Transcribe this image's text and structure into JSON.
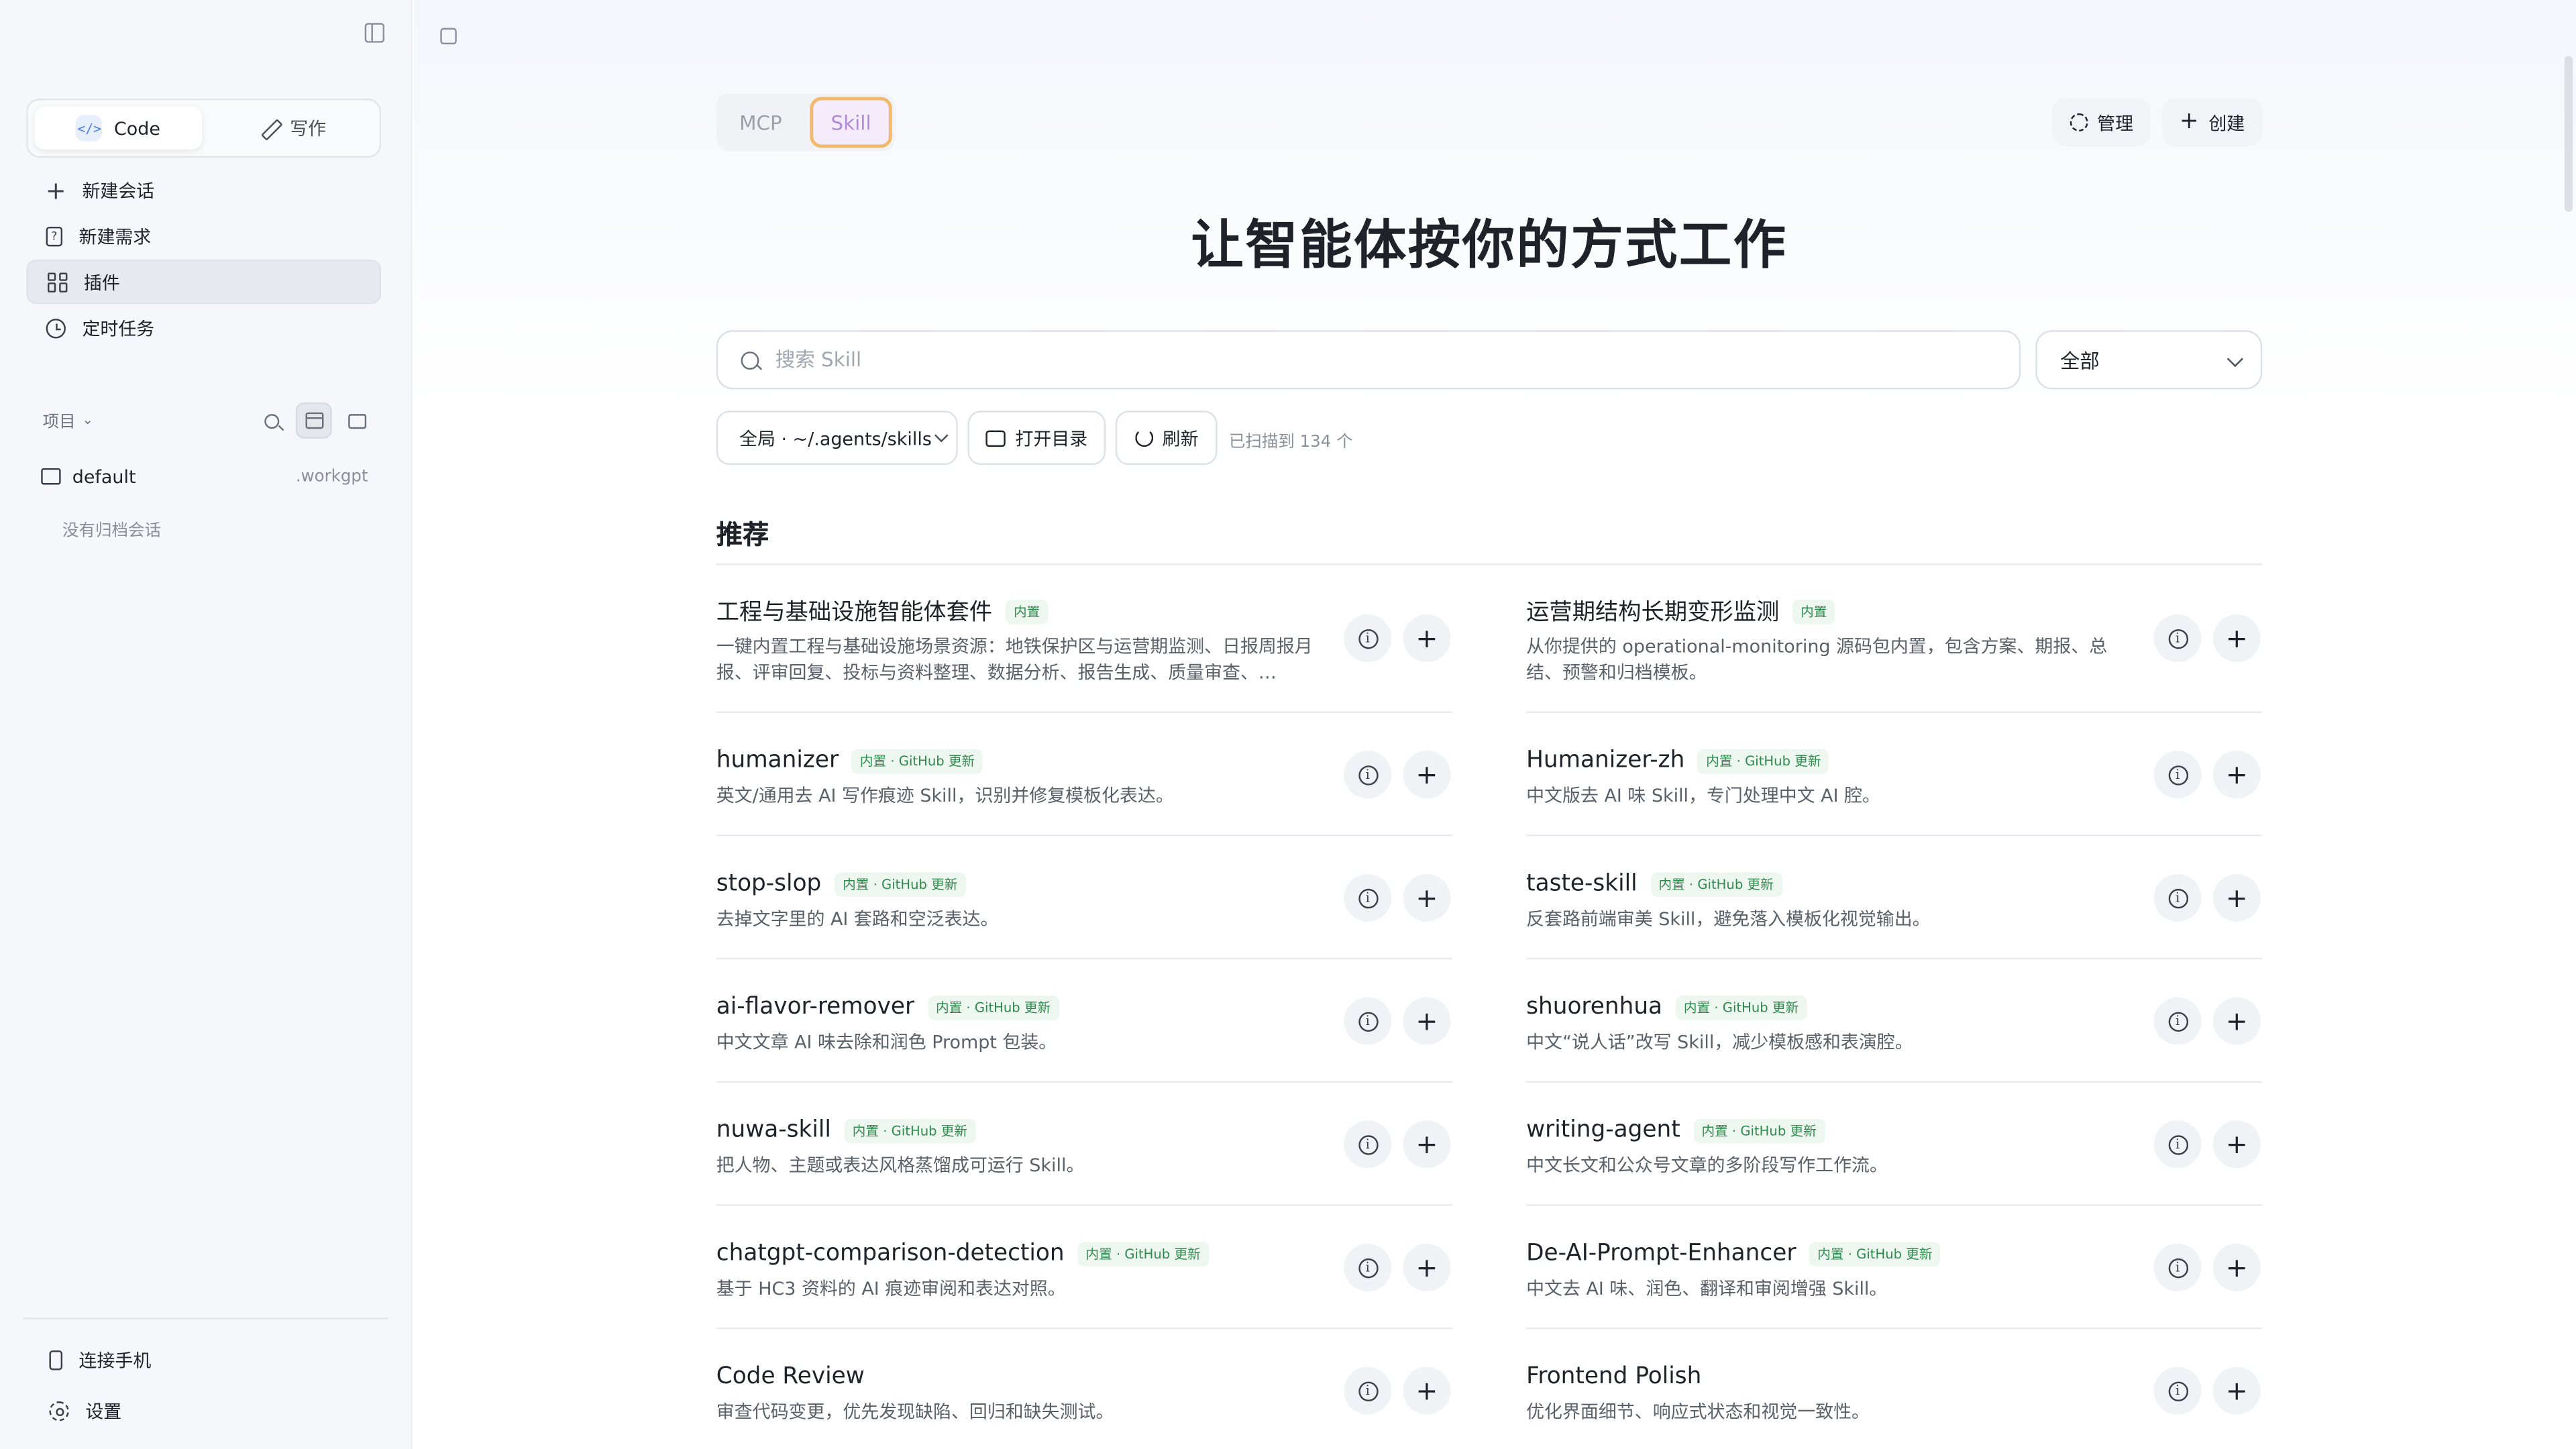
{
  "sidebar": {
    "mode_tabs": [
      {
        "label": "Code",
        "icon": "code-icon",
        "active": true
      },
      {
        "label": "写作",
        "icon": "pen-icon",
        "active": false
      }
    ],
    "nav": [
      {
        "label": "新建会话",
        "icon": "plus-icon"
      },
      {
        "label": "新建需求",
        "icon": "document-icon"
      },
      {
        "label": "插件",
        "icon": "grid-icon",
        "active": true
      },
      {
        "label": "定时任务",
        "icon": "clock-icon"
      }
    ],
    "projects_label": "项目",
    "folder": {
      "name": "default",
      "suffix": ".workgpt"
    },
    "empty_note": "没有归档会话",
    "bottom": [
      {
        "label": "连接手机",
        "icon": "phone-icon"
      },
      {
        "label": "设置",
        "icon": "gear-icon"
      }
    ]
  },
  "main": {
    "tabs": [
      "MCP",
      "Skill"
    ],
    "active_tab": "Skill",
    "manage_label": "管理",
    "create_label": "创建",
    "headline": "让智能体按你的方式工作",
    "search_placeholder": "搜索 Skill",
    "filter_value": "全部",
    "scope_value": "全局 · ~/.agents/skills",
    "open_dir_label": "打开目录",
    "refresh_label": "刷新",
    "scan_text": "已扫描到 134 个",
    "section_title": "推荐",
    "skills": [
      {
        "name": "工程与基础设施智能体套件",
        "badge": "内置",
        "desc": "一键内置工程与基础设施场景资源：地铁保护区与运营期监测、日报周报月报、评审回复、投标与资料整理、数据分析、报告生成、质量审查、…"
      },
      {
        "name": "运营期结构长期变形监测",
        "badge": "内置",
        "desc": "从你提供的 operational-monitoring 源码包内置，包含方案、期报、总结、预警和归档模板。"
      },
      {
        "name": "humanizer",
        "badge": "内置 · GitHub 更新",
        "desc": "英文/通用去 AI 写作痕迹 Skill，识别并修复模板化表达。"
      },
      {
        "name": "Humanizer-zh",
        "badge": "内置 · GitHub 更新",
        "desc": "中文版去 AI 味 Skill，专门处理中文 AI 腔。"
      },
      {
        "name": "stop-slop",
        "badge": "内置 · GitHub 更新",
        "desc": "去掉文字里的 AI 套路和空泛表达。"
      },
      {
        "name": "taste-skill",
        "badge": "内置 · GitHub 更新",
        "desc": "反套路前端审美 Skill，避免落入模板化视觉输出。"
      },
      {
        "name": "ai-flavor-remover",
        "badge": "内置 · GitHub 更新",
        "desc": "中文文章 AI 味去除和润色 Prompt 包装。"
      },
      {
        "name": "shuorenhua",
        "badge": "内置 · GitHub 更新",
        "desc": "中文“说人话”改写 Skill，减少模板感和表演腔。"
      },
      {
        "name": "nuwa-skill",
        "badge": "内置 · GitHub 更新",
        "desc": "把人物、主题或表达风格蒸馏成可运行 Skill。"
      },
      {
        "name": "writing-agent",
        "badge": "内置 · GitHub 更新",
        "desc": "中文长文和公众号文章的多阶段写作工作流。"
      },
      {
        "name": "chatgpt-comparison-detection",
        "badge": "内置 · GitHub 更新",
        "desc": "基于 HC3 资料的 AI 痕迹审阅和表达对照。"
      },
      {
        "name": "De-AI-Prompt-Enhancer",
        "badge": "内置 · GitHub 更新",
        "desc": "中文去 AI 味、润色、翻译和审阅增强 Skill。"
      },
      {
        "name": "Code Review",
        "badge": "",
        "desc": "审查代码变更，优先发现缺陷、回归和缺失测试。"
      },
      {
        "name": "Frontend Polish",
        "badge": "",
        "desc": "优化界面细节、响应式状态和视觉一致性。"
      }
    ]
  }
}
